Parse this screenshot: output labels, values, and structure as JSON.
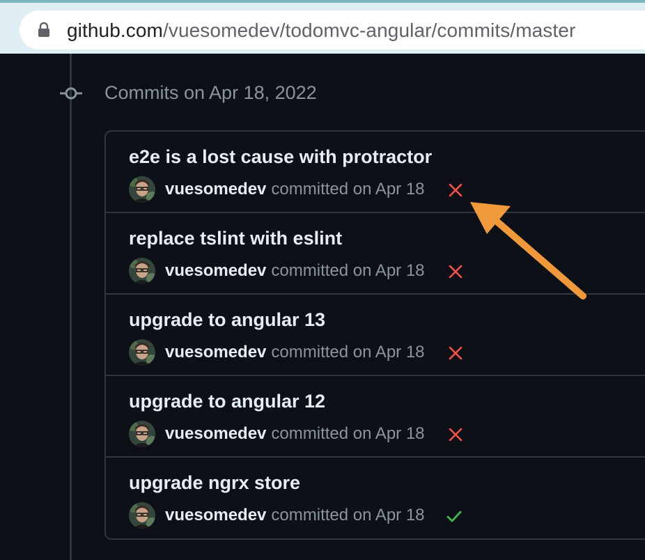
{
  "browser": {
    "url_host": "github.com",
    "url_path": "/vuesomedev/todomvc-angular/commits/master"
  },
  "timeline": {
    "date_heading": "Commits on Apr 18, 2022"
  },
  "commits": [
    {
      "title": "e2e is a lost cause with protractor",
      "author": "vuesomedev",
      "meta": "committed on Apr 18",
      "status": "failure"
    },
    {
      "title": "replace tslint with eslint",
      "author": "vuesomedev",
      "meta": "committed on Apr 18",
      "status": "failure"
    },
    {
      "title": "upgrade to angular 13",
      "author": "vuesomedev",
      "meta": "committed on Apr 18",
      "status": "failure"
    },
    {
      "title": "upgrade to angular 12",
      "author": "vuesomedev",
      "meta": "committed on Apr 18",
      "status": "failure"
    },
    {
      "title": "upgrade ngrx store",
      "author": "vuesomedev",
      "meta": "committed on Apr 18",
      "status": "success"
    }
  ],
  "colors": {
    "failure": "#f85149",
    "success": "#3fb950",
    "annotation_arrow": "#f0993a",
    "background": "#0d1117",
    "border": "#30363d"
  },
  "icons": {
    "failure": "x-icon",
    "success": "check-icon",
    "node": "git-commit-icon",
    "lock": "lock-icon"
  }
}
